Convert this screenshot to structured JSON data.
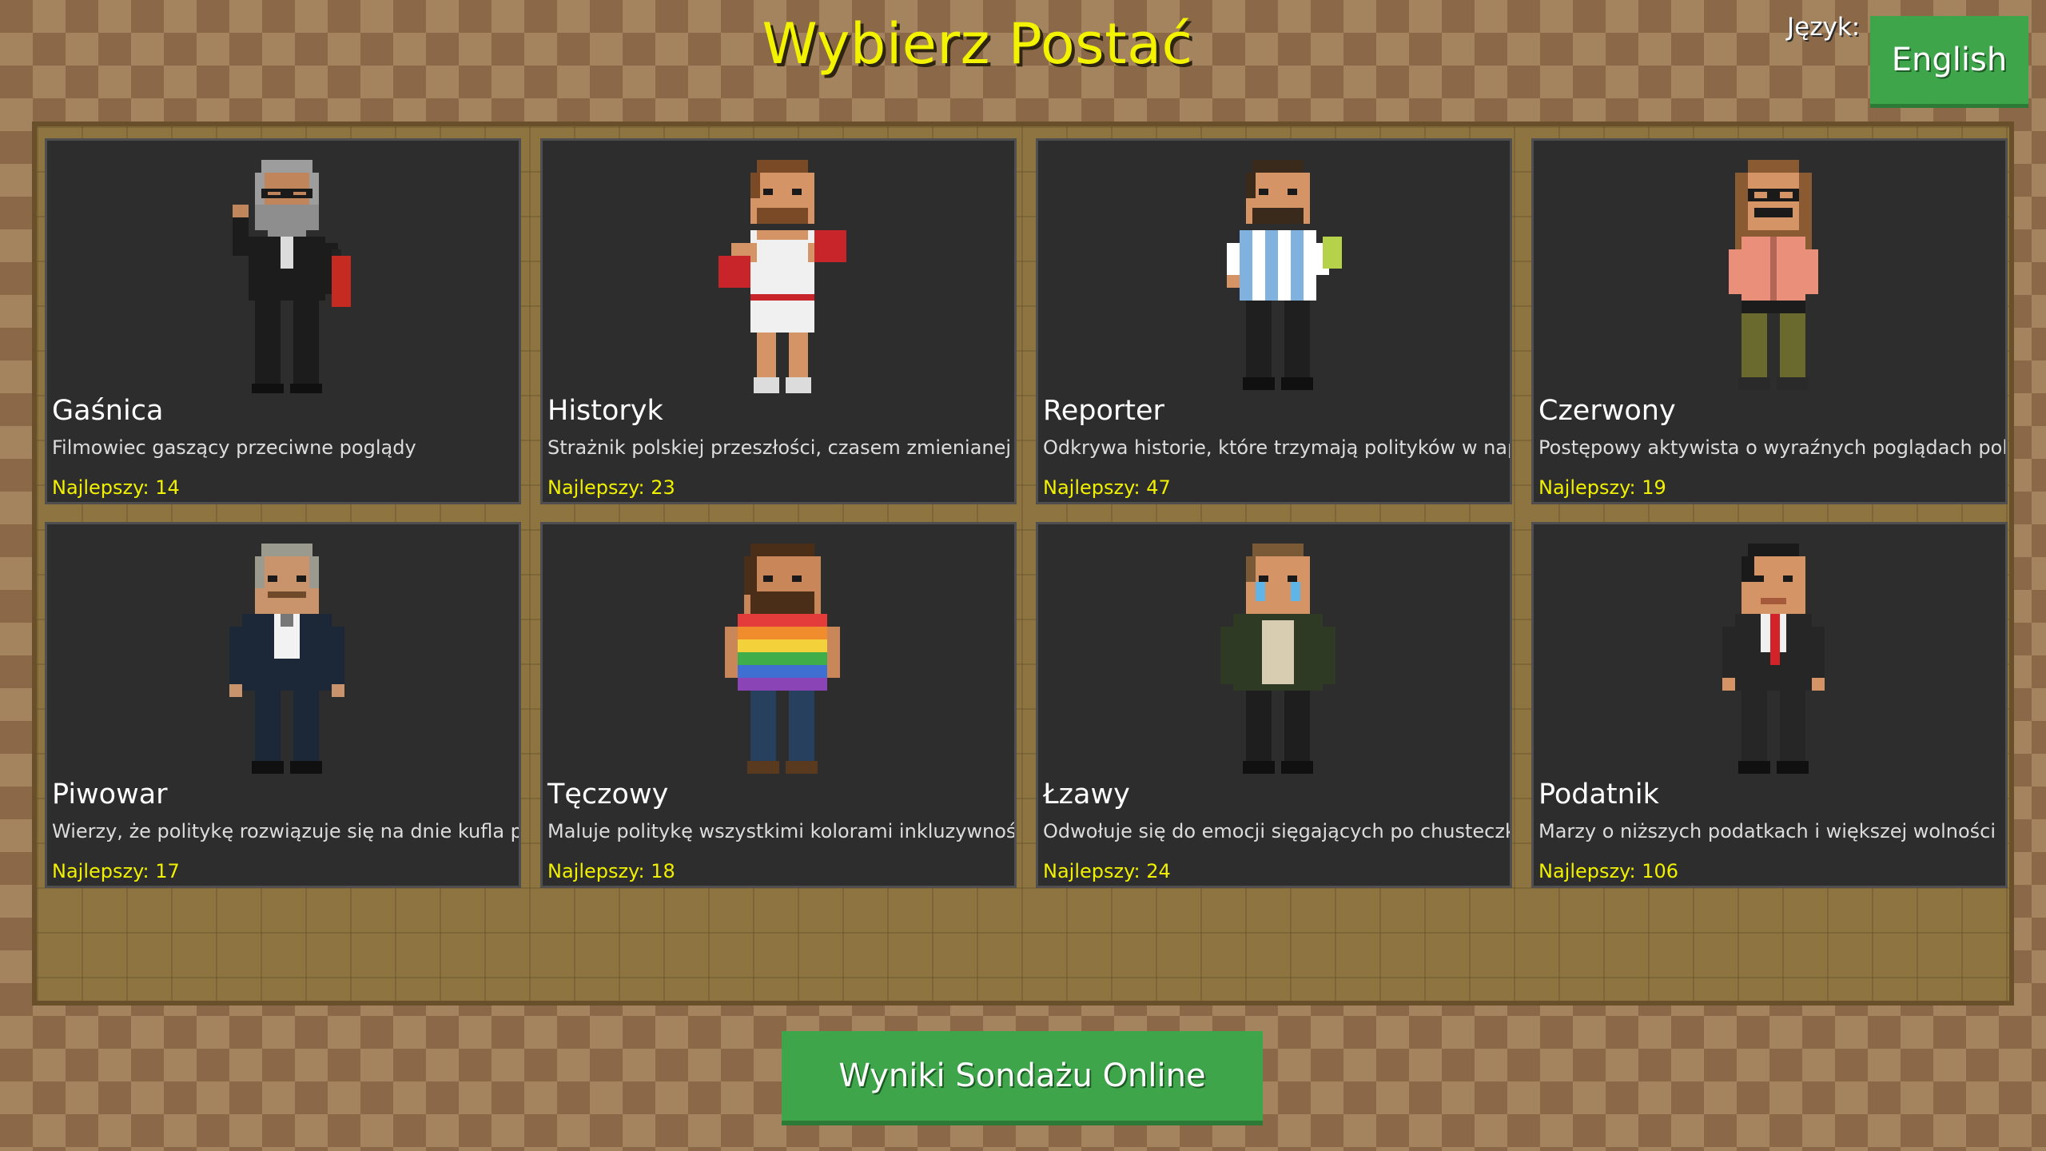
{
  "title": "Wybierz Postać",
  "language": {
    "label": "Język:",
    "button": "English"
  },
  "characters": [
    {
      "name": "Gaśnica",
      "description": "Filmowiec gaszący przeciwne poglądy",
      "best": "Najlepszy: 14",
      "best_score": 14,
      "sprite": "old-bearded-man-with-glasses-fire-extinguisher"
    },
    {
      "name": "Historyk",
      "description": "Strażnik polskiej przeszłości, czasem zmienianej",
      "best": "Najlepszy: 23",
      "best_score": 23,
      "sprite": "boxer-with-red-gloves"
    },
    {
      "name": "Reporter",
      "description": "Odkrywa historie, które trzymają polityków w napięciu",
      "best": "Najlepszy: 47",
      "best_score": 47,
      "sprite": "bearded-man-striped-shirt-holding-card"
    },
    {
      "name": "Czerwony",
      "description": "Postępowy aktywista o wyraźnych poglądach politycznych",
      "best": "Najlepszy: 19",
      "best_score": 19,
      "sprite": "long-haired-man-with-glasses-pink-shirt"
    },
    {
      "name": "Piwowar",
      "description": "Wierzy, że politykę rozwiązuje się na dnie kufla piwa",
      "best": "Najlepszy: 17",
      "best_score": 17,
      "sprite": "grey-haired-man-with-mustache-suit"
    },
    {
      "name": "Tęczowy",
      "description": "Maluje politykę wszystkimi kolorami inkluzywności",
      "best": "Najlepszy: 18",
      "best_score": 18,
      "sprite": "bearded-man-rainbow-shirt"
    },
    {
      "name": "Łzawy",
      "description": "Odwołuje się do emocji sięgających po chusteczki",
      "best": "Najlepszy: 24",
      "best_score": 24,
      "sprite": "crying-man-green-jacket"
    },
    {
      "name": "Podatnik",
      "description": "Marzy o niższych podatkach i większej wolności",
      "best": "Najlepszy: 106",
      "best_score": 106,
      "sprite": "man-black-suit-red-tie"
    }
  ],
  "poll_button": "Wyniki Sondażu Online"
}
